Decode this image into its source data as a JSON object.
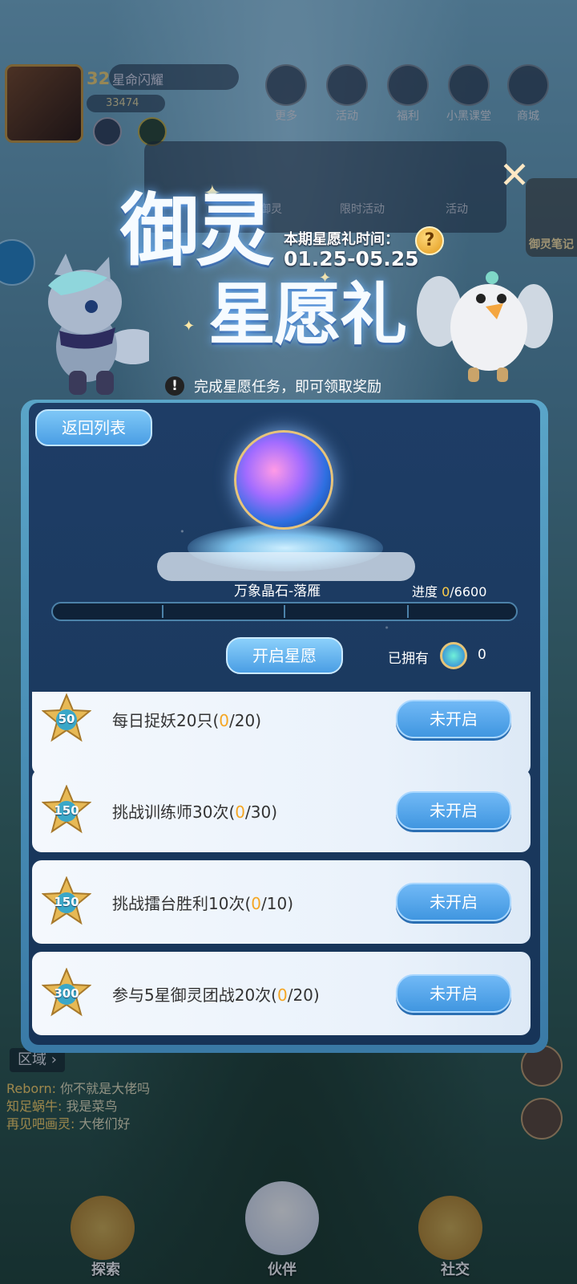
{
  "player": {
    "level": "32",
    "name": "星命闪耀",
    "power": "33474"
  },
  "top_menu": [
    {
      "label": "更多",
      "icon": "grid-icon"
    },
    {
      "label": "活动",
      "icon": "gift-icon"
    },
    {
      "label": "福利",
      "icon": "star-box-icon"
    },
    {
      "label": "小黑课堂",
      "icon": "cat-icon"
    },
    {
      "label": "商城",
      "icon": "shop-icon"
    }
  ],
  "sub_menu": [
    "御灵",
    "限时活动",
    "活动"
  ],
  "side_note": "御灵笔记",
  "event": {
    "title_line1": "御灵",
    "title_line2": "星愿礼",
    "period_label": "本期星愿礼时间：",
    "period_dates": "01.25-05.25",
    "help": "?",
    "close": "✕",
    "tip": "完成星愿任务，即可领取奖励"
  },
  "panel": {
    "back_label": "返回列表",
    "item_name": "万象晶石-落雁",
    "progress_label": "进度 ",
    "progress_current": "0",
    "progress_total": "/6600",
    "progress_fraction": 0,
    "start_label": "开启星愿",
    "owned_label": "已拥有",
    "owned_count": "0"
  },
  "tasks": [
    {
      "points": "50",
      "text": "每日捉妖20只(",
      "cur": "0",
      "total": "/20)",
      "button": "未开启"
    },
    {
      "points": "150",
      "text": "挑战训练师30次(",
      "cur": "0",
      "total": "/30)",
      "button": "未开启"
    },
    {
      "points": "150",
      "text": "挑战擂台胜利10次(",
      "cur": "0",
      "total": "/10)",
      "button": "未开启"
    },
    {
      "points": "300",
      "text": "参与5星御灵团战20次(",
      "cur": "0",
      "total": "/20)",
      "button": "未开启"
    }
  ],
  "region": "区域 ›",
  "chat": [
    {
      "nick": "Reborn:",
      "msg": " 你不就是大佬吗"
    },
    {
      "nick": "知足蜗牛:",
      "msg": " 我是菜鸟"
    },
    {
      "nick": "再见吧画灵:",
      "msg": " 大佬们好"
    }
  ],
  "bottom_nav": [
    {
      "label": "探索"
    },
    {
      "label": "伙伴"
    },
    {
      "label": "社交"
    }
  ],
  "colors": {
    "accent": "#4a9ee4",
    "highlight": "#ffcf4a",
    "panel": "#1e3d66"
  }
}
